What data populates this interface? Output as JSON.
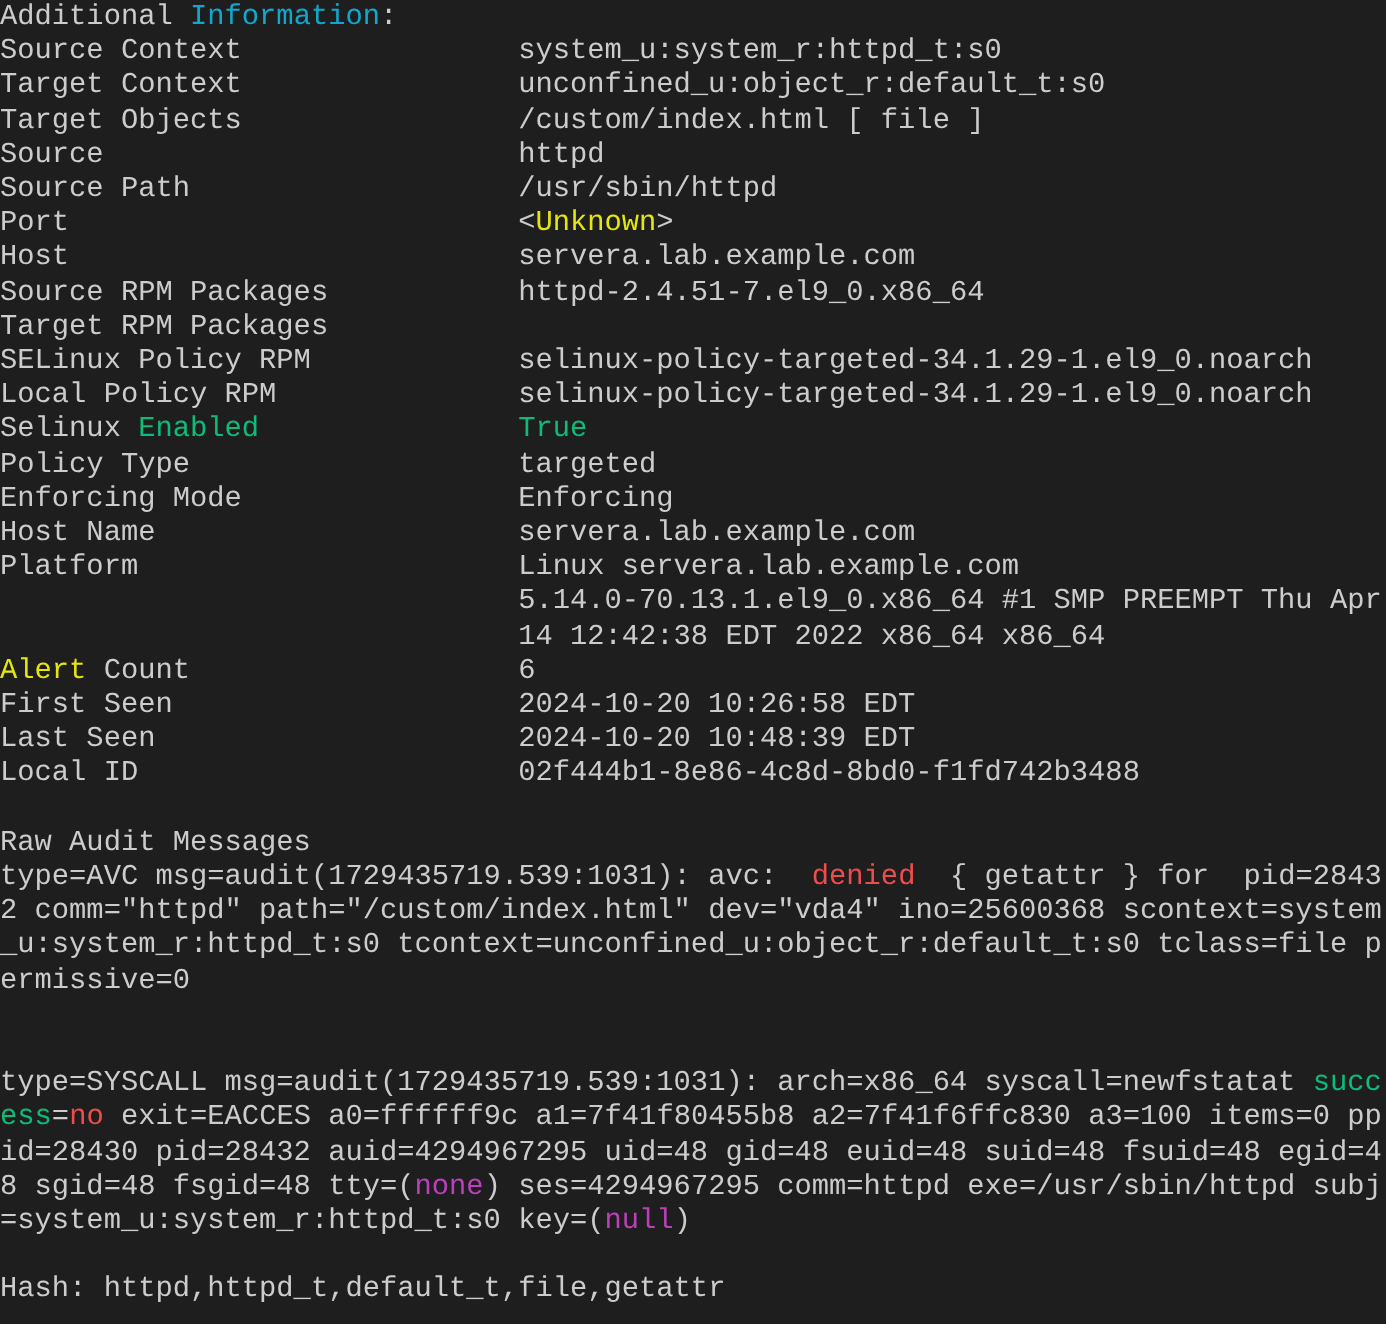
{
  "heading": [
    {
      "text": "Additional "
    },
    {
      "text": "Information",
      "color": "#11a8cd"
    },
    {
      "text": ":"
    }
  ],
  "fields": [
    {
      "label": [
        {
          "text": "Source Context"
        }
      ],
      "value": [
        [
          {
            "text": "system_u:system_r:httpd_t:s0"
          }
        ]
      ]
    },
    {
      "label": [
        {
          "text": "Target Context"
        }
      ],
      "value": [
        [
          {
            "text": "unconfined_u:object_r:default_t:s0"
          }
        ]
      ]
    },
    {
      "label": [
        {
          "text": "Target Objects"
        }
      ],
      "value": [
        [
          {
            "text": "/custom/index.html [ file ]"
          }
        ]
      ]
    },
    {
      "label": [
        {
          "text": "Source"
        }
      ],
      "value": [
        [
          {
            "text": "httpd"
          }
        ]
      ]
    },
    {
      "label": [
        {
          "text": "Source Path"
        }
      ],
      "value": [
        [
          {
            "text": "/usr/sbin/httpd"
          }
        ]
      ]
    },
    {
      "label": [
        {
          "text": "Port"
        }
      ],
      "value": [
        [
          {
            "text": "<"
          },
          {
            "text": "Unknown",
            "color": "#e5e510"
          },
          {
            "text": ">"
          }
        ]
      ]
    },
    {
      "label": [
        {
          "text": "Host"
        }
      ],
      "value": [
        [
          {
            "text": "servera.lab.example.com"
          }
        ]
      ]
    },
    {
      "label": [
        {
          "text": "Source RPM Packages"
        }
      ],
      "value": [
        [
          {
            "text": "httpd-2.4.51-7.el9_0.x86_64"
          }
        ]
      ]
    },
    {
      "label": [
        {
          "text": "Target RPM Packages"
        }
      ]
    },
    {
      "label": [
        {
          "text": "SELinux Policy RPM"
        }
      ],
      "value": [
        [
          {
            "text": "selinux-policy-targeted-34.1.29-1.el9_0.noarch"
          }
        ]
      ]
    },
    {
      "label": [
        {
          "text": "Local Policy RPM"
        }
      ],
      "value": [
        [
          {
            "text": "selinux-policy-targeted-34.1.29-1.el9_0.noarch"
          }
        ]
      ]
    },
    {
      "label": [
        {
          "text": "Selinux "
        },
        {
          "text": "Enabled",
          "color": "#0dbc79"
        }
      ],
      "value": [
        [
          {
            "text": "True",
            "color": "#0dbc79"
          }
        ]
      ]
    },
    {
      "label": [
        {
          "text": "Policy Type"
        }
      ],
      "value": [
        [
          {
            "text": "targeted"
          }
        ]
      ]
    },
    {
      "label": [
        {
          "text": "Enforcing Mode"
        }
      ],
      "value": [
        [
          {
            "text": "Enforcing"
          }
        ]
      ]
    },
    {
      "label": [
        {
          "text": "Host Name"
        }
      ],
      "value": [
        [
          {
            "text": "servera.lab.example.com"
          }
        ]
      ]
    },
    {
      "label": [
        {
          "text": "Platform"
        }
      ],
      "value": [
        [
          {
            "text": "Linux servera.lab.example.com"
          }
        ],
        [
          {
            "text": "5.14.0-70.13.1.el9_0.x86_64 #1 SMP PREEMPT Thu Apr"
          }
        ],
        [
          {
            "text": "14 12:42:38 EDT 2022 x86_64 x86_64"
          }
        ]
      ]
    },
    {
      "label": [
        {
          "text": "Alert",
          "color": "#e5e510"
        },
        {
          "text": " Count"
        }
      ],
      "value": [
        [
          {
            "text": "6"
          }
        ]
      ]
    },
    {
      "label": [
        {
          "text": "First Seen"
        }
      ],
      "value": [
        [
          {
            "text": "2024-10-20 10:26:58 EDT"
          }
        ]
      ]
    },
    {
      "label": [
        {
          "text": "Last Seen"
        }
      ],
      "value": [
        [
          {
            "text": "2024-10-20 10:48:39 EDT"
          }
        ]
      ]
    },
    {
      "label": [
        {
          "text": "Local ID"
        }
      ],
      "value": [
        [
          {
            "text": "02f444b1-8e86-4c8d-8bd0-f1fd742b3488"
          }
        ]
      ]
    }
  ],
  "raw_heading": "Raw Audit Messages",
  "raw_messages": [
    [
      {
        "text": "type=AVC msg=audit(1729435719.539:1031): avc:  "
      },
      {
        "text": "denied",
        "color": "#f14c4c"
      },
      {
        "text": "  { getattr } for  pid=28432 comm=\"httpd\" path=\"/custom/index.html\" dev=\"vda4\" ino=25600368 scontext=system_u:system_r:httpd_t:s0 tcontext=unconfined_u:object_r:default_t:s0 tclass=file permissive=0"
      }
    ],
    [
      {
        "text": "type=SYSCALL msg=audit(1729435719.539:1031): arch=x86_64 syscall=newfstatat "
      },
      {
        "text": "success",
        "color": "#0dbc79"
      },
      {
        "text": "="
      },
      {
        "text": "no",
        "color": "#f14c4c"
      },
      {
        "text": " exit=EACCES a0=ffffff9c a1=7f41f80455b8 a2=7f41f6ffc830 a3=100 items=0 ppid=28430 pid=28432 auid=4294967295 uid=48 gid=48 euid=48 suid=48 fsuid=48 egid=48 sgid=48 fsgid=48 tty=("
      },
      {
        "text": "none",
        "color": "#bc3fbc"
      },
      {
        "text": ") ses=4294967295 comm=httpd exe=/usr/sbin/httpd subj=system_u:system_r:httpd_t:s0 key=("
      },
      {
        "text": "null",
        "color": "#bc3fbc"
      },
      {
        "text": ")"
      }
    ]
  ],
  "hash": "Hash: httpd,httpd_t,default_t,file,getattr"
}
